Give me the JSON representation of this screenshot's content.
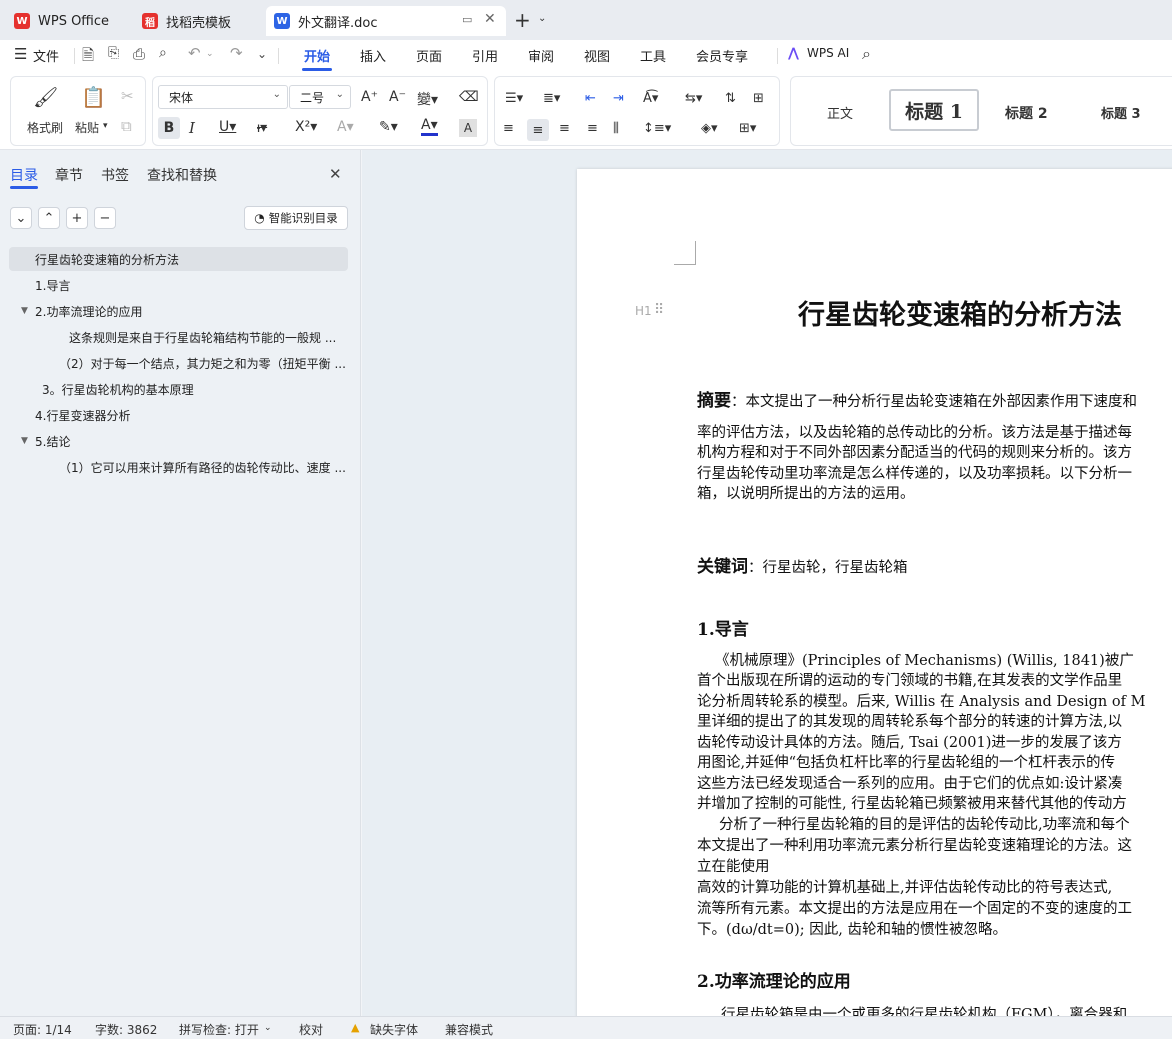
{
  "tabs": [
    {
      "label": "WPS Office",
      "icon": "wps-logo-icon"
    },
    {
      "label": "找稻壳模板",
      "icon": "docer-icon"
    },
    {
      "label": "外文翻译.doc",
      "icon": "word-doc-icon"
    }
  ],
  "menu": {
    "file": "文件",
    "items": [
      "开始",
      "插入",
      "页面",
      "引用",
      "审阅",
      "视图",
      "工具",
      "会员专享"
    ],
    "wps_ai": "WPS AI"
  },
  "ribbon": {
    "format_painter": "格式刷",
    "paste": "粘贴",
    "font_name": "宋体",
    "font_size": "二号",
    "styles": [
      "正文",
      "标题 1",
      "标题 2",
      "标题 3"
    ]
  },
  "nav": {
    "tabs": [
      "目录",
      "章节",
      "书签",
      "查找和替换"
    ],
    "smart_toc": "智能识别目录",
    "toc": [
      {
        "text": "行星齿轮变速箱的分析方法",
        "arrow": ""
      },
      {
        "text": "1.导言",
        "arrow": ""
      },
      {
        "text": "2.功率流理论的应用",
        "arrow": "▼"
      },
      {
        "text": "这条规则是来自于行星齿轮箱结构节能的一般规 ...",
        "arrow": ""
      },
      {
        "text": "（2）对于每一个结点，其力矩之和为零（扭矩平衡 ...",
        "arrow": ""
      },
      {
        "text": "3。行星齿轮机构的基本原理",
        "arrow": ""
      },
      {
        "text": "4.行星变速器分析",
        "arrow": ""
      },
      {
        "text": "5.结论",
        "arrow": "▼"
      },
      {
        "text": "（1）它可以用来计算所有路径的齿轮传动比、速度 ...",
        "arrow": ""
      }
    ]
  },
  "doc": {
    "heading_marker": "H1",
    "title": "行星齿轮变速箱的分析方法",
    "abstract_label": "摘要",
    "abstract_lines": [
      "：本文提出了一种分析行星齿轮变速箱在外部因素作用下速度和",
      "率的评估方法，以及齿轮箱的总传动比的分析。该方法是基于描述每",
      "机构方程和对于不同外部因素分配适当的代码的规则来分析的。该方",
      "行星齿轮传动里功率流是怎么样传递的，以及功率损耗。以下分析一",
      "箱，以说明所提出的方法的运用。"
    ],
    "keywords_label": "关键词",
    "keywords": "：行星齿轮，行星齿轮箱",
    "sec1": "1.导言",
    "body_lines": [
      "《机械原理》(Principles of Mechanisms) (Willis, 1841)被广",
      "首个出版现在所谓的运动的专门领域的书籍,在其发表的文学作品里",
      "论分析周转轮系的模型。后来, Willis 在 Analysis and Design of M",
      "里详细的提出了的其发现的周转轮系每个部分的转速的计算方法,以",
      "齿轮传动设计具体的方法。随后, Tsai (2001)进一步的发展了该方",
      "用图论,并延伸“包括负杠杆比率的行星齿轮组的一个杠杆表示的传",
      "这些方法已经发现适合一系列的应用。由于它们的优点如:设计紧凑",
      "并增加了控制的可能性, 行星齿轮箱已频繁被用来替代其他的传动方",
      "分析了一种行星齿轮箱的目的是评估的齿轮传动比,功率流和每个",
      "本文提出了一种利用功率流元素分析行星齿轮变速箱理论的方法。这",
      "立在能使用",
      "高效的计算功能的计算机基础上,并评估齿轮传动比的符号表达式,",
      "流等所有元素。本文提出的方法是应用在一个固定的不变的速度的工",
      "下。(dω/dt=0); 因此, 齿轮和轴的惯性被忽略。"
    ],
    "sec2": "2.功率流理论的应用",
    "last_line": "行星齿轮箱是由一个或更多的行星齿轮机构（FGM），离合器和"
  },
  "status": {
    "page": "页面: 1/14",
    "words": "字数: 3862",
    "spell": "拼写检查: 打开",
    "proof": "校对",
    "missing_font": "缺失字体",
    "compat": "兼容模式"
  },
  "colors": {
    "accent": "#2b5ce6",
    "wps_red": "#e5312e",
    "doc_blue": "#2d64e5"
  }
}
